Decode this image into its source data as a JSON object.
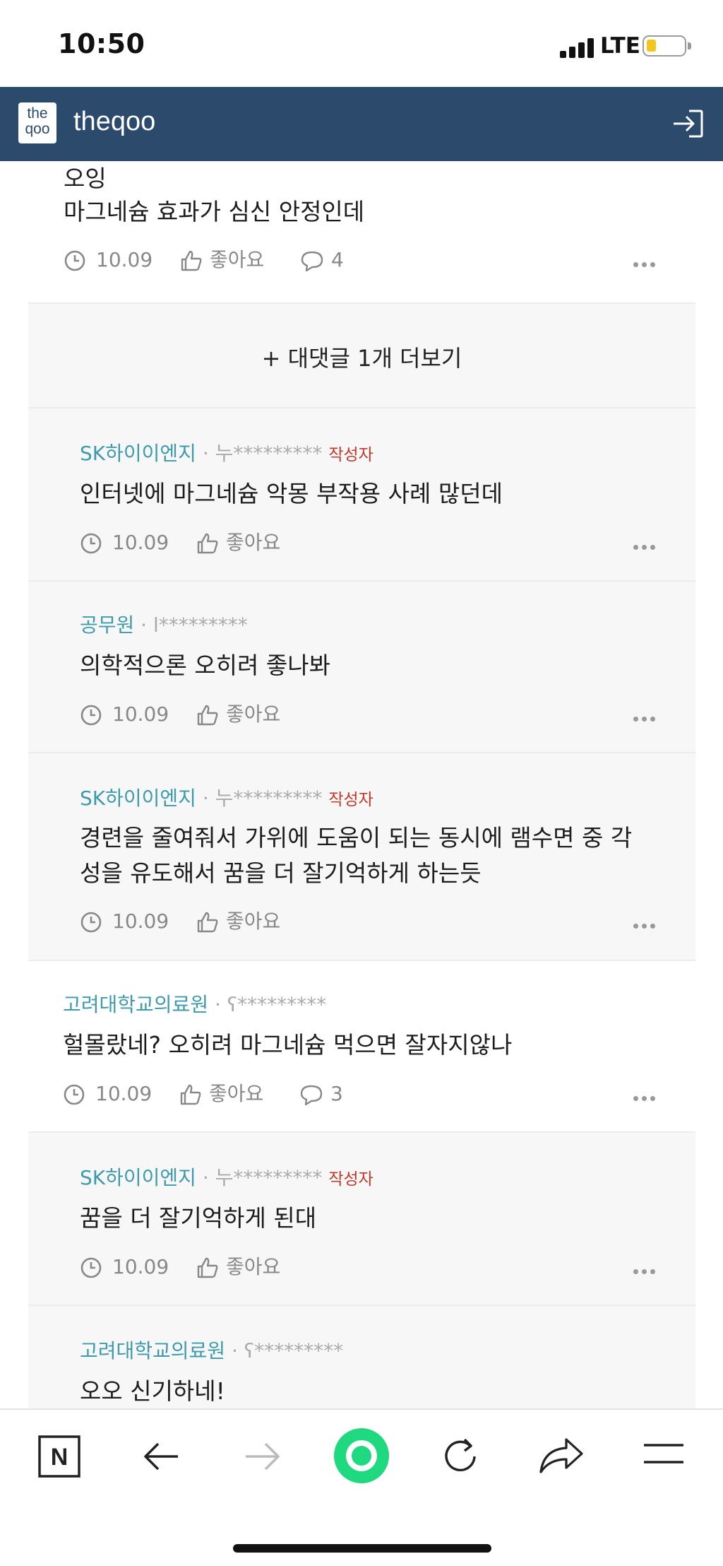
{
  "status_bar": {
    "time": "10:50",
    "network": "LTE"
  },
  "header": {
    "logo_text_1": "the",
    "logo_text_2": "qoo",
    "title": "theqoo"
  },
  "top_comment": {
    "line1": "오잉",
    "line2": "마그네슘 효과가 심신 안정인데",
    "date": "10.09",
    "like_label": "좋아요",
    "reply_count": "4"
  },
  "load_more": {
    "label": "+ 대댓글 1개 더보기"
  },
  "comments": [
    {
      "author": "SK하이이엔지",
      "user": "누*********",
      "writer_tag": "작성자",
      "text": "인터넷에 마그네슘 악몽 부작용 사례 많던데",
      "date": "10.09",
      "like_label": "좋아요"
    },
    {
      "author": "공무원",
      "user": "l*********",
      "writer_tag": "",
      "text": "의학적으론 오히려 좋나봐",
      "date": "10.09",
      "like_label": "좋아요"
    },
    {
      "author": "SK하이이엔지",
      "user": "누*********",
      "writer_tag": "작성자",
      "text_line1": "경련을 줄여줘서 가위에 도움이 되는 동시에 램수면 중 각",
      "text_line2": "성을 유도해서 꿈을 더 잘기억하게 하는듯",
      "date": "10.09",
      "like_label": "좋아요"
    },
    {
      "author": "고려대학교의료원",
      "user": "ʕ*********",
      "writer_tag": "",
      "text": "헐몰랐네? 오히려 마그네슘 먹으면 잘자지않나",
      "date": "10.09",
      "like_label": "좋아요",
      "reply_count": "3"
    },
    {
      "author": "SK하이이엔지",
      "user": "누*********",
      "writer_tag": "작성자",
      "text": "꿈을 더 잘기억하게 된대",
      "date": "10.09",
      "like_label": "좋아요"
    },
    {
      "author": "고려대학교의료원",
      "user": "ʕ*********",
      "writer_tag": "",
      "text": "오오 신기하네!"
    }
  ],
  "toolbar": {
    "n_label": "N"
  }
}
